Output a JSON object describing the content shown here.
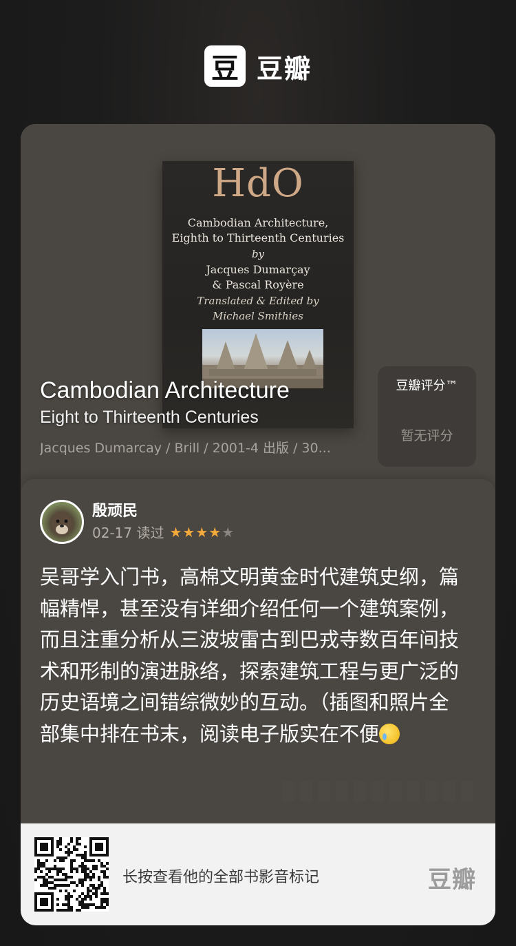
{
  "brand": {
    "logo_char": "豆",
    "name": "豆瓣"
  },
  "book": {
    "cover": {
      "series": "HdO",
      "title_line1": "Cambodian Architecture,",
      "title_line2": "Eighth to Thirteenth Centuries",
      "by": "by",
      "author_line1": "Jacques Dumarçay",
      "author_line2": "& Pascal Royère",
      "translated_line1": "Translated & Edited by",
      "translated_line2": "Michael Smithies"
    },
    "title": "Cambodian Architecture",
    "subtitle": "Eight to Thirteenth Centuries",
    "meta": "Jacques Dumarcay / Brill / 2001-4 出版 / 30..."
  },
  "rating": {
    "label": "豆瓣评分™",
    "value": "暂无评分"
  },
  "comment": {
    "user": "殷顽民",
    "date_status": "02-17 读过",
    "stars": 4,
    "max_stars": 5,
    "text": "吴哥学入门书，高棉文明黄金时代建筑史纲，篇幅精悍，甚至没有详细介绍任何一个建筑案例，而且注重分析从三波坡雷古到巴戎寺数百年间技术和形制的演进脉络，探索建筑工程与更广泛的历史语境之间错综微妙的互动。（插图和照片全部集中排在书末，阅读电子版实在不便",
    "emoji": "crying-face-icon"
  },
  "footer": {
    "cta": "长按查看他的全部书影音标记",
    "brand": "豆瓣"
  },
  "colors": {
    "star_on": "#f2a83a",
    "star_off": "#8a8580",
    "card_bg": "#4a4541",
    "footer_bg": "#f2f2f2"
  }
}
